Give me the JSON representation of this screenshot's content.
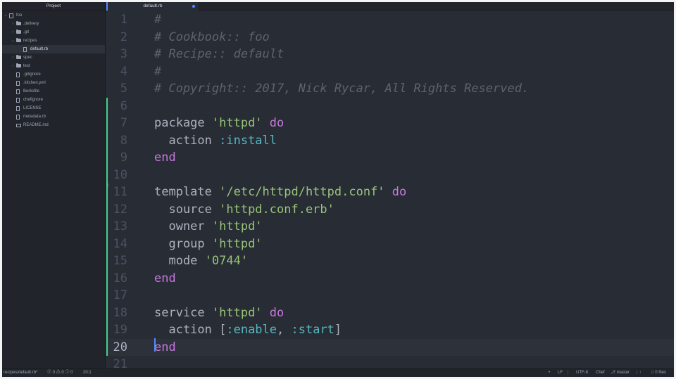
{
  "sidebar": {
    "title": "Project",
    "tree": [
      {
        "label": "foo",
        "type": "repo",
        "depth": 0,
        "expanded": true
      },
      {
        "label": ".delivery",
        "type": "folder",
        "depth": 1,
        "expanded": false
      },
      {
        "label": ".git",
        "type": "folder",
        "depth": 1,
        "expanded": false
      },
      {
        "label": "recipes",
        "type": "folder",
        "depth": 1,
        "expanded": true
      },
      {
        "label": "default.rb",
        "type": "file",
        "depth": 2,
        "selected": true
      },
      {
        "label": "spec",
        "type": "folder",
        "depth": 1,
        "expanded": false
      },
      {
        "label": "test",
        "type": "folder",
        "depth": 1,
        "expanded": false
      },
      {
        "label": ".gitignore",
        "type": "file",
        "depth": 1
      },
      {
        "label": ".kitchen.yml",
        "type": "file",
        "depth": 1
      },
      {
        "label": "Berksfile",
        "type": "file",
        "depth": 1
      },
      {
        "label": "chefignore",
        "type": "file",
        "depth": 1
      },
      {
        "label": "LICENSE",
        "type": "file",
        "depth": 1
      },
      {
        "label": "metadata.rb",
        "type": "file",
        "depth": 1
      },
      {
        "label": "README.md",
        "type": "book",
        "depth": 1
      }
    ]
  },
  "tab": {
    "title": "default.rb",
    "modified": true
  },
  "editor": {
    "current_line": 20,
    "lines": [
      {
        "n": "1",
        "tokens": [
          {
            "t": "#",
            "c": "comment"
          }
        ]
      },
      {
        "n": "2",
        "tokens": [
          {
            "t": "# Cookbook:: foo",
            "c": "comment"
          }
        ]
      },
      {
        "n": "3",
        "tokens": [
          {
            "t": "# Recipe:: default",
            "c": "comment"
          }
        ]
      },
      {
        "n": "4",
        "tokens": [
          {
            "t": "#",
            "c": "comment"
          }
        ]
      },
      {
        "n": "5",
        "tokens": [
          {
            "t": "# Copyright:: 2017, Nick Rycar, All Rights Reserved.",
            "c": "comment"
          }
        ]
      },
      {
        "n": "6",
        "tokens": [],
        "git": true
      },
      {
        "n": "7",
        "tokens": [
          {
            "t": "package ",
            "c": "plain"
          },
          {
            "t": "'httpd'",
            "c": "str"
          },
          {
            "t": " ",
            "c": "plain"
          },
          {
            "t": "do",
            "c": "kw"
          }
        ],
        "git": true
      },
      {
        "n": "8",
        "tokens": [
          {
            "t": "  action ",
            "c": "plain"
          },
          {
            "t": ":install",
            "c": "sym"
          }
        ],
        "git": true
      },
      {
        "n": "9",
        "tokens": [
          {
            "t": "end",
            "c": "kw"
          }
        ],
        "git": true
      },
      {
        "n": "10",
        "tokens": [],
        "git": true
      },
      {
        "n": "11",
        "tokens": [
          {
            "t": "template ",
            "c": "plain"
          },
          {
            "t": "'/etc/httpd/httpd.conf'",
            "c": "str"
          },
          {
            "t": " ",
            "c": "plain"
          },
          {
            "t": "do",
            "c": "kw"
          }
        ],
        "git": true
      },
      {
        "n": "12",
        "tokens": [
          {
            "t": "  source ",
            "c": "plain"
          },
          {
            "t": "'httpd.conf.erb'",
            "c": "str"
          }
        ],
        "git": true
      },
      {
        "n": "13",
        "tokens": [
          {
            "t": "  owner ",
            "c": "plain"
          },
          {
            "t": "'httpd'",
            "c": "str"
          }
        ],
        "git": true
      },
      {
        "n": "14",
        "tokens": [
          {
            "t": "  group ",
            "c": "plain"
          },
          {
            "t": "'httpd'",
            "c": "str"
          }
        ],
        "git": true
      },
      {
        "n": "15",
        "tokens": [
          {
            "t": "  mode ",
            "c": "plain"
          },
          {
            "t": "'0744'",
            "c": "str"
          }
        ],
        "git": true
      },
      {
        "n": "16",
        "tokens": [
          {
            "t": "end",
            "c": "kw"
          }
        ],
        "git": true
      },
      {
        "n": "17",
        "tokens": [],
        "git": true
      },
      {
        "n": "18",
        "tokens": [
          {
            "t": "service ",
            "c": "plain"
          },
          {
            "t": "'httpd'",
            "c": "str"
          },
          {
            "t": " ",
            "c": "plain"
          },
          {
            "t": "do",
            "c": "kw"
          }
        ],
        "git": true
      },
      {
        "n": "19",
        "tokens": [
          {
            "t": "  action [",
            "c": "plain"
          },
          {
            "t": ":enable",
            "c": "sym"
          },
          {
            "t": ", ",
            "c": "plain"
          },
          {
            "t": ":start",
            "c": "sym"
          },
          {
            "t": "]",
            "c": "plain"
          }
        ],
        "git": true
      },
      {
        "n": "20",
        "tokens": [
          {
            "t": "end",
            "c": "kw"
          }
        ],
        "git": true
      },
      {
        "n": "21",
        "tokens": []
      }
    ]
  },
  "statusbar": {
    "path": "recipes/default.rb*",
    "errors": "0",
    "warnings": "0",
    "infos": "0",
    "cursor_pos": "20:1",
    "line_ending": "LF",
    "encoding": "UTF-8",
    "grammar": "Chef",
    "branch": "master",
    "files": "0 files"
  }
}
